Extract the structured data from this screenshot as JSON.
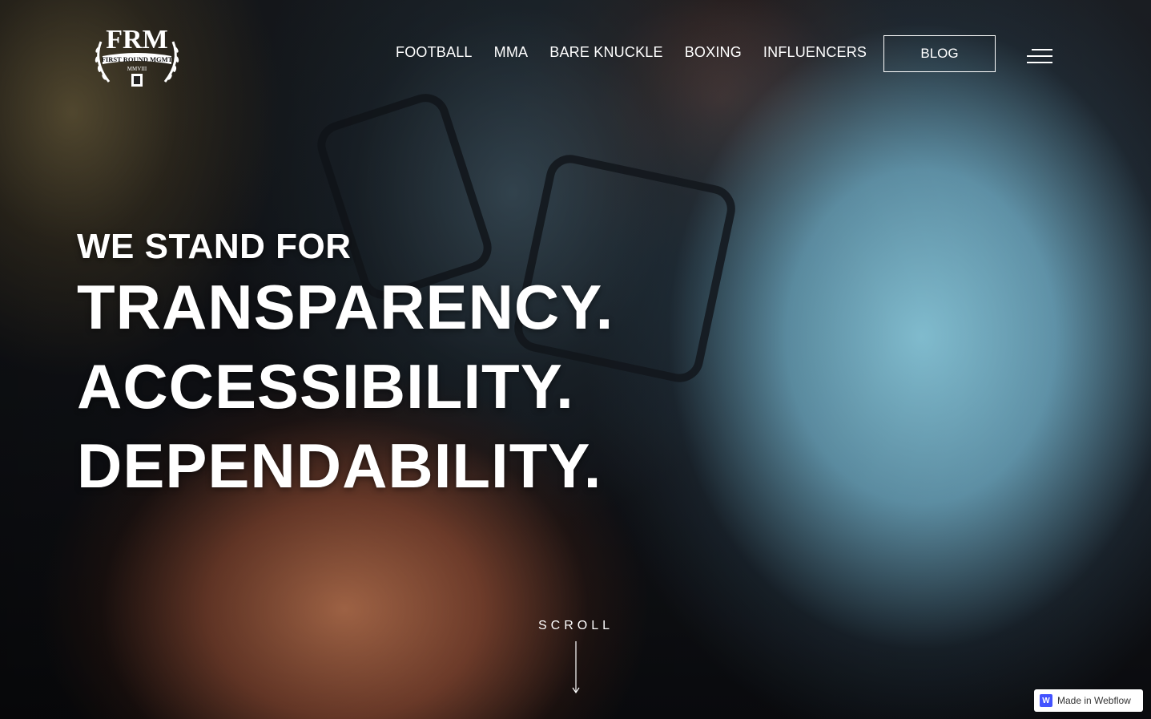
{
  "brand": {
    "logo_main": "FRM",
    "logo_banner": "FIRST ROUND MGMT",
    "logo_roman": "MMVIII"
  },
  "nav": {
    "items": [
      {
        "label": "FOOTBALL"
      },
      {
        "label": "MMA"
      },
      {
        "label": "BARE KNUCKLE"
      },
      {
        "label": "BOXING"
      },
      {
        "label": "INFLUENCERS"
      }
    ],
    "blog_label": "BLOG",
    "menu_icon": "hamburger-menu-icon"
  },
  "hero": {
    "kicker": "WE STAND FOR",
    "words": [
      "TRANSPARENCY.",
      "ACCESSIBILITY.",
      "DEPENDABILITY."
    ],
    "scroll_label": "SCROLL"
  },
  "badge": {
    "icon": "webflow-logo-icon",
    "label": "Made in Webflow"
  },
  "colors": {
    "text": "#ffffff",
    "webflow_blue": "#4353ff"
  }
}
